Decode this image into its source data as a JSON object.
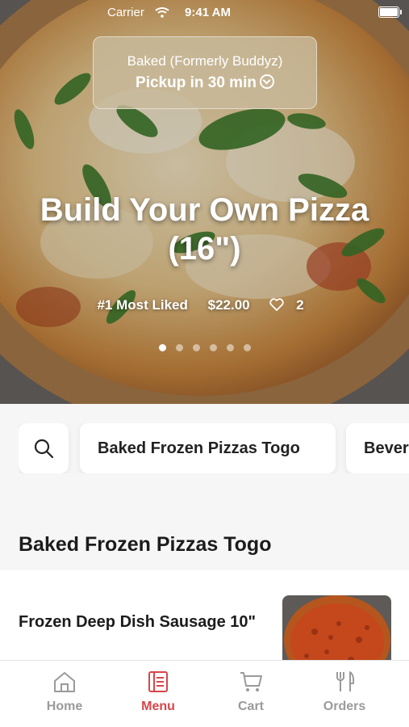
{
  "status_bar": {
    "carrier": "Carrier",
    "time": "9:41 AM"
  },
  "store_pill": {
    "store_name": "Baked (Formerly Buddyz)",
    "pickup": "Pickup in 30 min"
  },
  "hero": {
    "title": "Build Your Own Pizza (16\")",
    "badge": "#1 Most Liked",
    "price": "$22.00",
    "likes": "2",
    "carousel_page_count": 6,
    "carousel_active_index": 0
  },
  "categories": {
    "search_icon": "search-icon",
    "items": [
      "Baked Frozen Pizzas Togo",
      "Bever"
    ]
  },
  "section": {
    "title": "Baked Frozen Pizzas Togo"
  },
  "menu_items": [
    {
      "name": "Frozen Deep Dish Sausage 10\""
    }
  ],
  "tab_bar": {
    "tabs": [
      {
        "label": "Home",
        "icon": "home-icon",
        "active": false
      },
      {
        "label": "Menu",
        "icon": "menu-book-icon",
        "active": true
      },
      {
        "label": "Cart",
        "icon": "cart-icon",
        "active": false
      },
      {
        "label": "Orders",
        "icon": "fork-knife-icon",
        "active": false
      }
    ]
  },
  "colors": {
    "accent": "#d8454a",
    "inactive": "#9a9a9a"
  }
}
